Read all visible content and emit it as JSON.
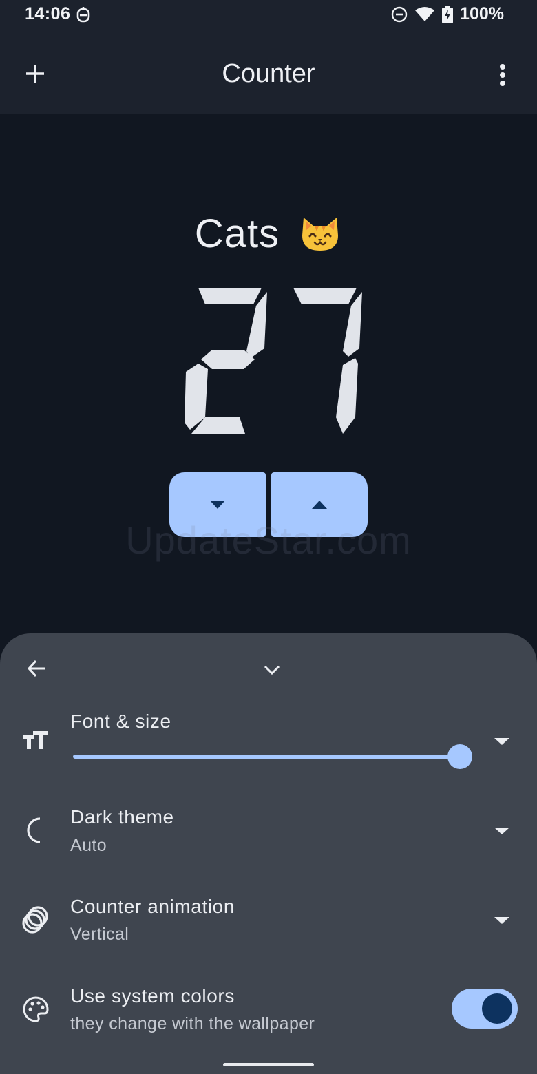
{
  "status_bar": {
    "time": "14:06",
    "battery": "100%",
    "icons": [
      "assistant-icon",
      "do-not-disturb-icon",
      "wifi-icon",
      "battery-charging-icon"
    ]
  },
  "app_bar": {
    "title": "Counter",
    "add_icon": "plus-icon",
    "menu_icon": "more-vert-icon"
  },
  "counter": {
    "name": "Cats",
    "emoji": "cat-face-emoji",
    "value": "27",
    "decrement_icon": "arrow-down-icon",
    "increment_icon": "arrow-up-icon"
  },
  "watermark": "UpdateStar.com",
  "settings_sheet": {
    "back_icon": "arrow-back-icon",
    "collapse_icon": "chevron-down-icon",
    "items": [
      {
        "title": "Font & size",
        "icon": "text-size-icon",
        "slider_value": 1.0
      },
      {
        "title": "Dark theme",
        "subtitle": "Auto",
        "icon": "moon-icon"
      },
      {
        "title": "Counter animation",
        "subtitle": "Vertical",
        "icon": "animation-icon"
      },
      {
        "title": "Use system colors",
        "subtitle": "they change with the wallpaper",
        "icon": "palette-icon",
        "enabled": true
      }
    ]
  },
  "colors": {
    "accent": "#a6c8ff",
    "background": "#111721",
    "app_bar": "#1c222d",
    "sheet": "#3f454f",
    "digit": "#e1e4ea",
    "toggle_knob": "#0d325f"
  }
}
